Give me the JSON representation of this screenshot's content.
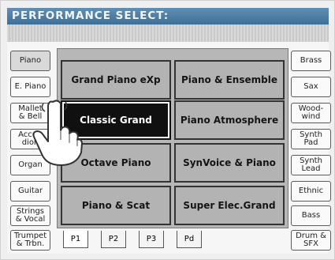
{
  "header": {
    "title": "PERFORMANCE SELECT:"
  },
  "left_banks": [
    "Piano",
    "E. Piano",
    "Mallet\n& Bell",
    "Accor-\ndion",
    "Organ",
    "Guitar",
    "Strings\n& Vocal",
    "Trumpet\n& Trbn."
  ],
  "right_banks": [
    "Brass",
    "Sax",
    "Wood-\nwind",
    "Synth\nPad",
    "Synth\nLead",
    "Ethnic",
    "Bass",
    "Drum &\nSFX"
  ],
  "performances": [
    {
      "label": "Grand Piano eXp",
      "selected": false
    },
    {
      "label": "Piano & Ensemble",
      "selected": false
    },
    {
      "label": "Classic Grand",
      "selected": true
    },
    {
      "label": "Piano Atmosphere",
      "selected": false
    },
    {
      "label": "Octave Piano",
      "selected": false
    },
    {
      "label": "SynVoice & Piano",
      "selected": false
    },
    {
      "label": "Piano & Scat",
      "selected": false
    },
    {
      "label": "Super Elec.Grand",
      "selected": false
    }
  ],
  "pages": [
    "P1",
    "P2",
    "P3",
    "Pd"
  ],
  "active_page": "P1",
  "active_bank": "Piano",
  "colors": {
    "titlebar": "#4a7aa0",
    "selected_bg": "#101010",
    "button_bg": "#b3b3b3"
  }
}
